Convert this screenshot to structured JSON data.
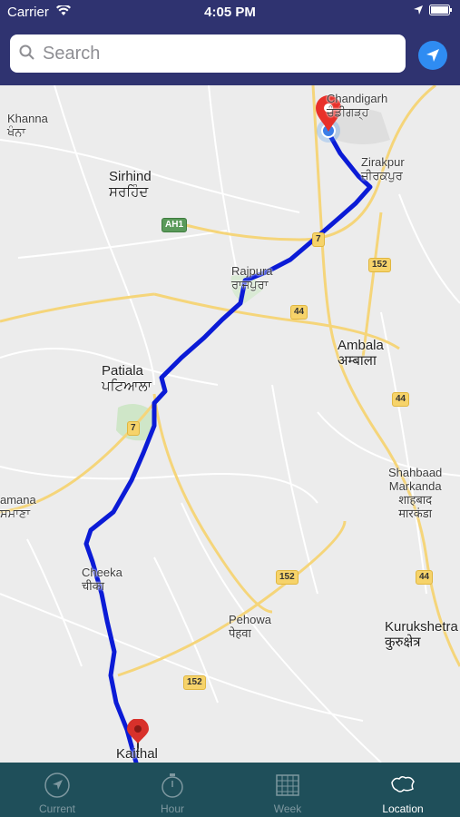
{
  "status_bar": {
    "carrier": "Carrier",
    "time": "4:05 PM"
  },
  "search": {
    "placeholder": "Search"
  },
  "map": {
    "places": {
      "chandigarh_en": "Chandigarh",
      "chandigarh_pa": "ਚੰਡੀਗੜ੍ਹ",
      "khanna_en": "Khanna",
      "khanna_pa": "ਖੰਨਾ",
      "zirakpur_en": "Zirakpur",
      "zirakpur_pa": "ਜ਼ੀਰਕਪੁਰ",
      "sirhind_en": "Sirhind",
      "sirhind_pa": "ਸਰਹਿੰਦ",
      "rajpura_en": "Rajpura",
      "rajpura_pa": "ਰਾਜਪੁਰਾ",
      "ambala_en": "Ambala",
      "ambala_hi": "अम्बाला",
      "patiala_en": "Patiala",
      "patiala_pa": "ਪਟਿਆਲਾ",
      "shahbaad_en": "Shahbaad",
      "markanda_en": "Markanda",
      "shahbaad_hi": "शाहबाद",
      "markanda_hi": "मारकंडा",
      "samana_en": "amana",
      "samana_pa": "ਸਮਾਣਾ",
      "cheeka_en": "Cheeka",
      "cheeka_hi": "चीका",
      "pehowa_en": "Pehowa",
      "pehowa_hi": "पेहवा",
      "kurukshetra_en": "Kurukshetra",
      "kurukshetra_hi": "कुरुक्षेत्र",
      "kaithal_en": "Kaithal"
    },
    "shields": {
      "ah1": "AH1",
      "s7a": "7",
      "s152a": "152",
      "s44a": "44",
      "s44b": "44",
      "s7b": "7",
      "s152b": "152",
      "s44c": "44",
      "s152c": "152"
    }
  },
  "tabs": [
    {
      "label": "Current",
      "active": false
    },
    {
      "label": "Hour",
      "active": false
    },
    {
      "label": "Week",
      "active": false
    },
    {
      "label": "Location",
      "active": true
    }
  ],
  "colors": {
    "bar": "#2f3370",
    "route": "#0b1bd6",
    "tab_bar": "#1f4f5a",
    "pin": "#e8302a"
  }
}
